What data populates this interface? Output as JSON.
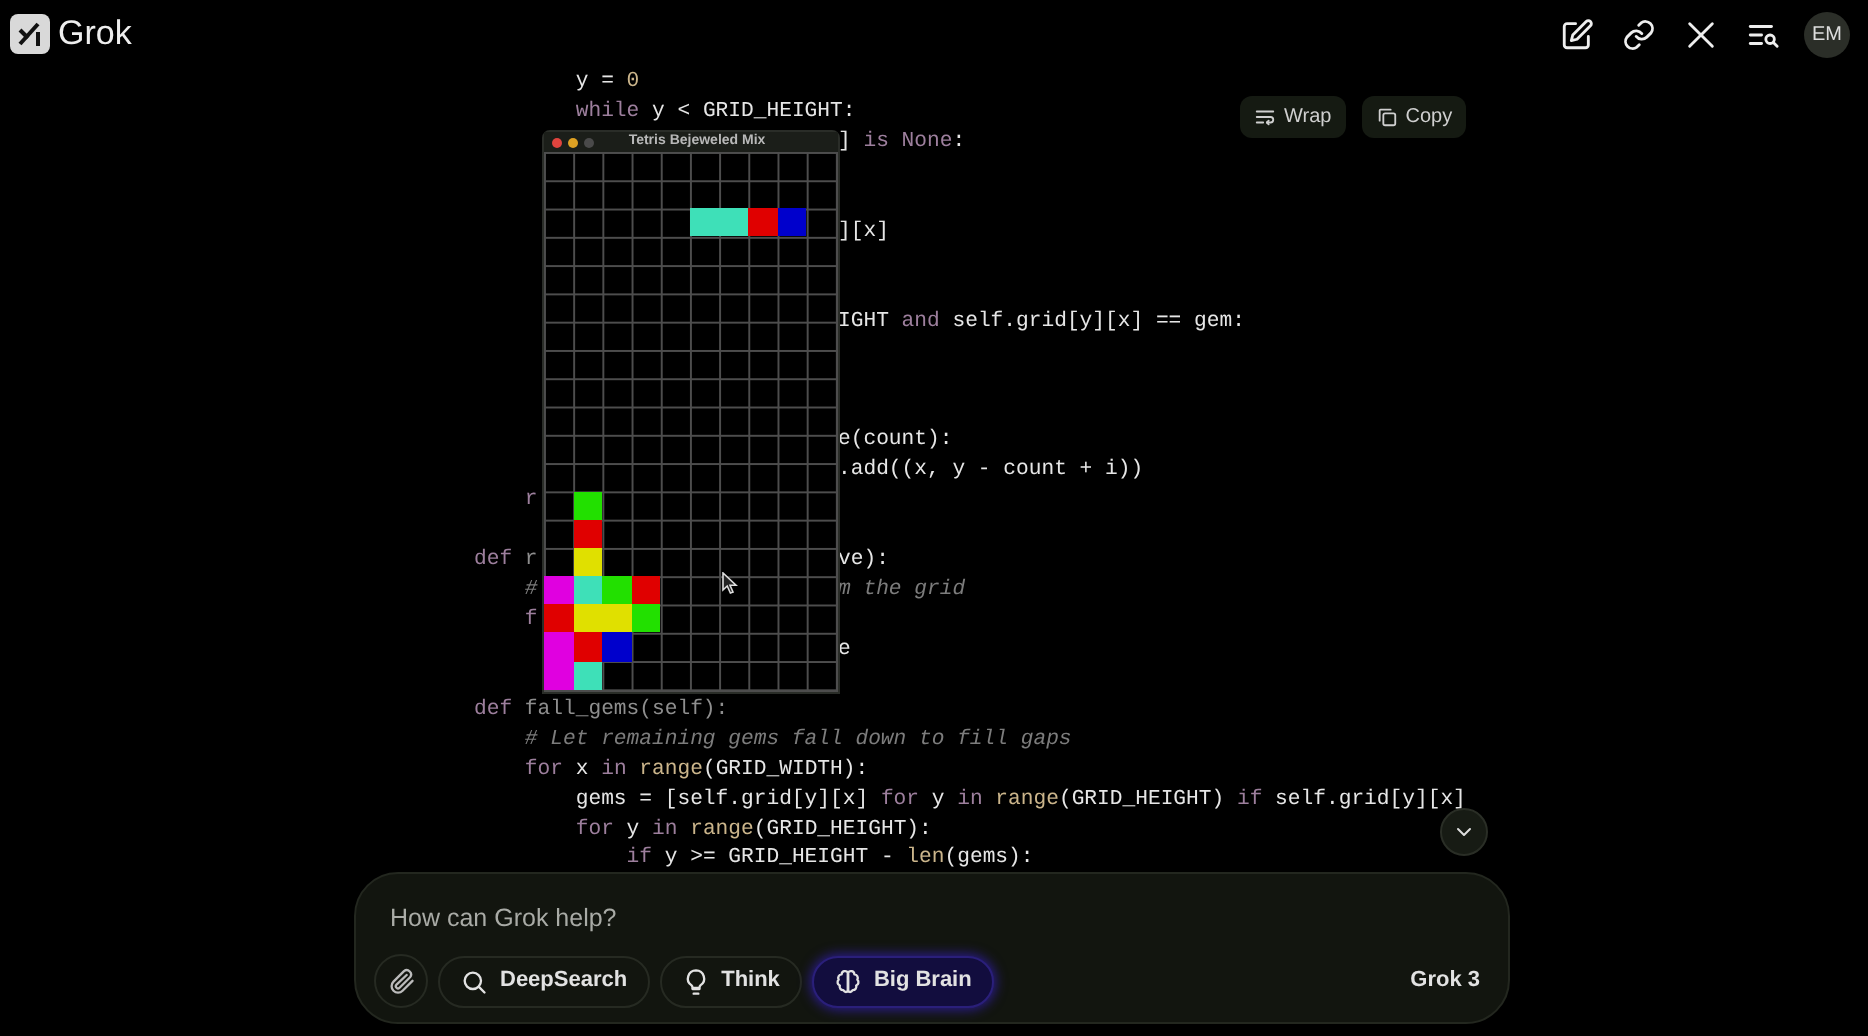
{
  "header": {
    "brand": "Grok",
    "avatar": "EM"
  },
  "code_toolbar": [
    {
      "label": "Wrap",
      "kind": "wrap"
    },
    {
      "label": "Copy",
      "kind": "copy"
    }
  ],
  "code_lines": [
    {
      "left": [
        {
          "text": "        y = ",
          "kind": "plain"
        },
        {
          "text": "0",
          "kind": "num"
        }
      ]
    },
    {
      "left": [
        {
          "text": "        while",
          "kind": "kw"
        },
        {
          "text": " y < GRID_HEIGHT:",
          "kind": "plain"
        }
      ]
    },
    {
      "right": [
        {
          "text": "] ",
          "kind": "plain"
        },
        {
          "text": "is None",
          "kind": "kw"
        },
        {
          "text": ":",
          "kind": "plain"
        }
      ]
    },
    {
      "right": [
        {
          "text": "][x]",
          "kind": "plain"
        }
      ]
    },
    {
      "right": [
        {
          "text": "IGHT ",
          "kind": "plain"
        },
        {
          "text": "and",
          "kind": "kw"
        },
        {
          "text": " self.grid[y][x] == gem:",
          "kind": "plain"
        }
      ]
    },
    {
      "right": [
        {
          "text": "e(count):",
          "kind": "plain"
        }
      ]
    },
    {
      "right": [
        {
          "text": ".add((x, y - count + i))",
          "kind": "plain"
        }
      ]
    },
    {
      "left": [
        {
          "text": "    r",
          "kind": "kw"
        }
      ]
    },
    {
      "left": [
        {
          "text": "def",
          "kind": "kw"
        },
        {
          "text": " r",
          "kind": "fn"
        }
      ],
      "right": [
        {
          "text": "ve):",
          "kind": "plain"
        }
      ]
    },
    {
      "left": [
        {
          "text": "    #",
          "kind": "comment"
        }
      ],
      "right": [
        {
          "text": "m the grid",
          "kind": "comment"
        }
      ]
    },
    {
      "left": [
        {
          "text": "    f",
          "kind": "kw"
        }
      ]
    },
    {
      "right": [
        {
          "text": "e",
          "kind": "plain"
        }
      ]
    },
    {
      "left": [
        {
          "text": "def",
          "kind": "kw"
        },
        {
          "text": " fall_gems(self):",
          "kind": "fn"
        }
      ]
    },
    {
      "left": [
        {
          "text": "    # Let remaining gems fall down to fill gaps",
          "kind": "comment"
        }
      ]
    },
    {
      "left": [
        {
          "text": "    for",
          "kind": "kw"
        },
        {
          "text": " x ",
          "kind": "plain"
        },
        {
          "text": "in",
          "kind": "kw"
        },
        {
          "text": " range",
          "kind": "builtin"
        },
        {
          "text": "(GRID_WIDTH):",
          "kind": "plain"
        }
      ]
    },
    {
      "left": [
        {
          "text": "        gems = [self.grid[y][x] ",
          "kind": "plain"
        },
        {
          "text": "for",
          "kind": "kw"
        },
        {
          "text": " y ",
          "kind": "plain"
        },
        {
          "text": "in",
          "kind": "kw"
        },
        {
          "text": " range",
          "kind": "builtin"
        },
        {
          "text": "(GRID_HEIGHT) ",
          "kind": "plain"
        },
        {
          "text": "if",
          "kind": "kw"
        },
        {
          "text": " self.grid[y][x]",
          "kind": "plain"
        }
      ]
    },
    {
      "left": [
        {
          "text": "        for",
          "kind": "kw"
        },
        {
          "text": " y ",
          "kind": "plain"
        },
        {
          "text": "in",
          "kind": "kw"
        },
        {
          "text": " range",
          "kind": "builtin"
        },
        {
          "text": "(GRID_HEIGHT):",
          "kind": "plain"
        }
      ]
    },
    {
      "left": [
        {
          "text": "            if",
          "kind": "kw"
        },
        {
          "text": " y >= GRID_HEIGHT - ",
          "kind": "plain"
        },
        {
          "text": "len",
          "kind": "builtin"
        },
        {
          "text": "(gems):",
          "kind": "plain"
        }
      ]
    }
  ],
  "game_window": {
    "title": "Tetris Bejeweled Mix",
    "board": [
      {
        "cells": [
          null,
          null,
          null,
          null,
          null,
          null,
          null,
          null,
          null,
          null
        ]
      },
      {
        "cells": [
          null,
          null,
          null,
          null,
          null,
          null,
          null,
          null,
          null,
          null
        ]
      },
      {
        "cells": [
          null,
          null,
          null,
          null,
          null,
          {
            "color": "#3ee0b8"
          },
          {
            "color": "#3ee0b8"
          },
          {
            "color": "#e00000"
          },
          {
            "color": "#0000cc"
          },
          null
        ]
      },
      {
        "cells": [
          null,
          null,
          null,
          null,
          null,
          null,
          null,
          null,
          null,
          null
        ]
      },
      {
        "cells": [
          null,
          null,
          null,
          null,
          null,
          null,
          null,
          null,
          null,
          null
        ]
      },
      {
        "cells": [
          null,
          null,
          null,
          null,
          null,
          null,
          null,
          null,
          null,
          null
        ]
      },
      {
        "cells": [
          null,
          null,
          null,
          null,
          null,
          null,
          null,
          null,
          null,
          null
        ]
      },
      {
        "cells": [
          null,
          null,
          null,
          null,
          null,
          null,
          null,
          null,
          null,
          null
        ]
      },
      {
        "cells": [
          null,
          null,
          null,
          null,
          null,
          null,
          null,
          null,
          null,
          null
        ]
      },
      {
        "cells": [
          null,
          null,
          null,
          null,
          null,
          null,
          null,
          null,
          null,
          null
        ]
      },
      {
        "cells": [
          null,
          null,
          null,
          null,
          null,
          null,
          null,
          null,
          null,
          null
        ]
      },
      {
        "cells": [
          null,
          null,
          null,
          null,
          null,
          null,
          null,
          null,
          null,
          null
        ]
      },
      {
        "cells": [
          null,
          {
            "color": "#22e000"
          },
          null,
          null,
          null,
          null,
          null,
          null,
          null,
          null
        ]
      },
      {
        "cells": [
          null,
          {
            "color": "#e00000"
          },
          null,
          null,
          null,
          null,
          null,
          null,
          null,
          null
        ]
      },
      {
        "cells": [
          null,
          {
            "color": "#e0e000"
          },
          null,
          null,
          null,
          null,
          null,
          null,
          null,
          null
        ]
      },
      {
        "cells": [
          {
            "color": "#e000e0"
          },
          {
            "color": "#3ee0b8"
          },
          {
            "color": "#22e000"
          },
          {
            "color": "#e00000"
          },
          null,
          null,
          null,
          null,
          null,
          null
        ]
      },
      {
        "cells": [
          {
            "color": "#e00000"
          },
          {
            "color": "#e0e000"
          },
          {
            "color": "#e0e000"
          },
          {
            "color": "#22e000"
          },
          null,
          null,
          null,
          null,
          null,
          null
        ]
      },
      {
        "cells": [
          {
            "color": "#e000e0"
          },
          {
            "color": "#e00000"
          },
          {
            "color": "#0000cc"
          },
          null,
          null,
          null,
          null,
          null,
          null,
          null
        ]
      },
      {
        "cells": [
          {
            "color": "#e000e0"
          },
          {
            "color": "#3ee0b8"
          },
          null,
          null,
          null,
          null,
          null,
          null,
          null,
          null
        ]
      }
    ]
  },
  "composer": {
    "placeholder": "How can Grok help?",
    "modes": [
      {
        "label": "DeepSearch",
        "kind": "search",
        "selected": false
      },
      {
        "label": "Think",
        "kind": "think",
        "selected": false
      },
      {
        "label": "Big Brain",
        "kind": "brain",
        "selected": true
      }
    ],
    "model": "Grok 3"
  }
}
